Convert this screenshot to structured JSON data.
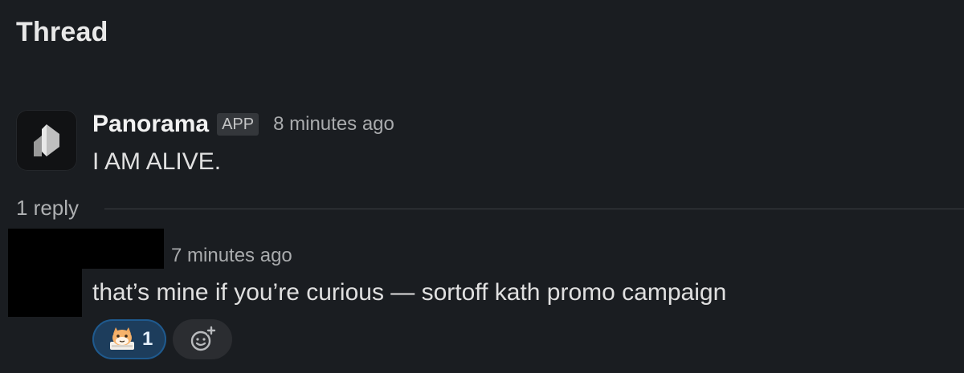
{
  "header": {
    "title": "Thread"
  },
  "parent_message": {
    "sender": "Panorama",
    "badge": "APP",
    "timestamp": "8 minutes ago",
    "text": "I AM ALIVE.",
    "avatar_icon": "panorama-logo-icon"
  },
  "replies_divider": {
    "label": "1 reply"
  },
  "reply": {
    "timestamp": "7 minutes ago",
    "text": "that’s mine if you’re curious — sortoff kath promo campaign",
    "reactions": [
      {
        "emoji_icon": "cat-emoji-icon",
        "count": "1"
      }
    ],
    "add_reaction_icon": "add-reaction-icon"
  },
  "colors": {
    "background": "#1a1d21",
    "reaction_bg": "#1d3d5c",
    "reaction_border": "#1f5a8e"
  }
}
